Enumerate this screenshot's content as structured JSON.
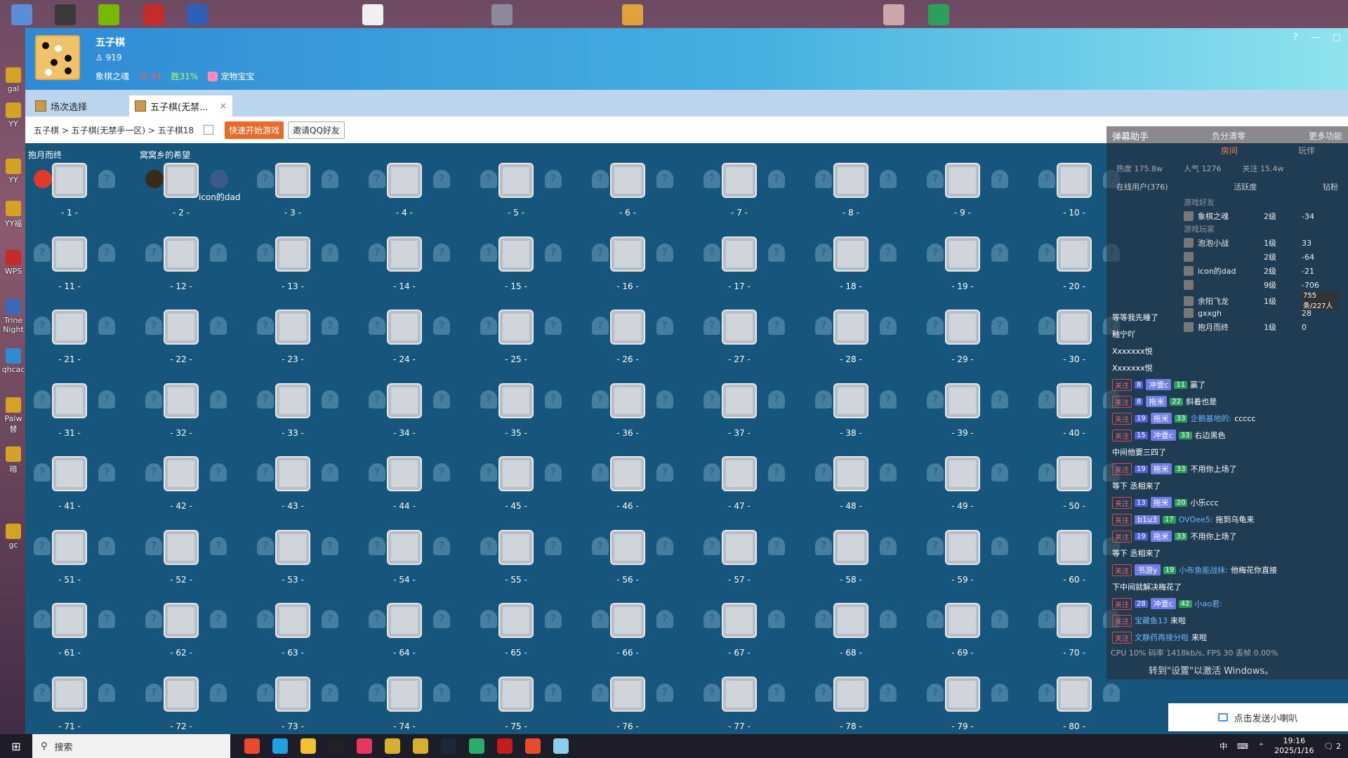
{
  "window": {
    "game_title": "五子棋",
    "points": "919",
    "rank_title": "象棋之魂",
    "score": "分-34",
    "win_rate": "胜31%",
    "pet": "宠物宝宝",
    "controls": [
      "?",
      "—",
      "□"
    ]
  },
  "tabs": [
    {
      "label": "场次选择"
    },
    {
      "label": "五子棋(无禁...",
      "close": "×"
    }
  ],
  "breadcrumb": {
    "path": "五子棋 > 五子棋(无禁手一区) > 五子棋18",
    "quick_start": "快速开始游戏",
    "invite": "邀请QQ好友"
  },
  "tables": {
    "numbers": [
      "- 1 -",
      "- 2 -",
      "- 3 -",
      "- 4 -",
      "- 5 -",
      "- 6 -",
      "- 7 -",
      "- 8 -",
      "- 9 -",
      "- 10 -",
      "- 11 -",
      "- 12 -",
      "- 13 -",
      "- 14 -",
      "- 15 -",
      "- 16 -",
      "- 17 -",
      "- 18 -",
      "- 19 -",
      "- 20 -",
      "- 21 -",
      "- 22 -",
      "- 23 -",
      "- 24 -",
      "- 25 -",
      "- 26 -",
      "- 27 -",
      "- 28 -",
      "- 29 -",
      "- 30 -",
      "- 31 -",
      "- 32 -",
      "- 33 -",
      "- 34 -",
      "- 35 -",
      "- 36 -",
      "- 37 -",
      "- 38 -",
      "- 39 -",
      "- 40 -",
      "- 41 -",
      "- 42 -",
      "- 43 -",
      "- 44 -",
      "- 45 -",
      "- 46 -",
      "- 47 -",
      "- 48 -",
      "- 49 -",
      "- 50 -",
      "- 51 -",
      "- 52 -",
      "- 53 -",
      "- 54 -",
      "- 55 -",
      "- 56 -",
      "- 57 -",
      "- 58 -",
      "- 59 -",
      "- 60 -",
      "- 61 -",
      "- 62 -",
      "- 63 -",
      "- 64 -",
      "- 65 -",
      "- 66 -",
      "- 67 -",
      "- 68 -",
      "- 69 -",
      "- 70 -",
      "- 71 -",
      "- 72 -",
      "- 73 -",
      "- 74 -",
      "- 75 -",
      "- 76 -",
      "- 77 -",
      "- 78 -",
      "- 79 -",
      "- 80 -"
    ],
    "seat_placeholder": "?",
    "table1_player": "抱月而终",
    "table2_player_left": "窝窝乡的希望",
    "table2_player_right": "icon的dad"
  },
  "right_panel": {
    "title": "弹幕助手",
    "more": "更多功能",
    "negative_clear": "负分清零",
    "tabs": [
      "房间",
      "玩伴"
    ],
    "stats": [
      "热度 175.8w",
      "人气 1276",
      "关注 15.4w"
    ],
    "online_users": "在线用户(376)",
    "activity": "活跃度",
    "diamond": "钻粉",
    "section_friends": "游戏好友",
    "section_players": "游戏玩家",
    "rank_rows": [
      {
        "name": "象棋之魂",
        "level": "2级",
        "score": "-34"
      },
      {
        "name": "泡泡小战",
        "level": "1级",
        "score": "33"
      },
      {
        "name": "",
        "level": "2级",
        "score": "-64"
      },
      {
        "name": "icon的dad",
        "level": "2级",
        "score": "-21"
      },
      {
        "name": "",
        "level": "9级",
        "score": "-706"
      },
      {
        "name": "余阳飞龙",
        "level": "1级",
        "score": ""
      },
      {
        "name": "gxxgh",
        "level": "",
        "score": "28"
      },
      {
        "name": "抱月而终",
        "level": "1级",
        "score": "0"
      }
    ],
    "counter": "755条/227人",
    "chat": [
      {
        "text": "等等我先睡了"
      },
      {
        "text": "釉宁吖"
      },
      {
        "text": "Xxxxxxx悦"
      },
      {
        "text": "Xxxxxxx悦"
      },
      {
        "follow": "关注",
        "lv": "8",
        "badge": "冲壹c",
        "fan": "11",
        "msg": "赢了"
      },
      {
        "follow": "关注",
        "lv": "8",
        "badge": "拖米",
        "fan": "22",
        "msg": "斜着也是"
      },
      {
        "follow": "关注",
        "lv": "19",
        "badge": "拖米",
        "fan": "33",
        "user": "企鹅基地的:",
        "msg": "ccccc"
      },
      {
        "follow": "关注",
        "lv": "15",
        "badge": "冲壹c",
        "fan": "33",
        "msg": "右边黑色"
      },
      {
        "text": "中间他要三四了"
      },
      {
        "follow": "关注",
        "lv": "19",
        "badge": "拖米",
        "fan": "33",
        "msg": "不用你上场了"
      },
      {
        "text": "等下 丞相来了"
      },
      {
        "follow": "关注",
        "lv": "13",
        "badge": "拖米",
        "fan": "20",
        "msg": "小乐ccc"
      },
      {
        "follow": "关注",
        "badge": "b1u3",
        "fan": "17",
        "user": "OVOee5:",
        "msg": "拖到乌龟来"
      },
      {
        "follow": "关注",
        "lv": "19",
        "badge": "拖米",
        "fan": "33",
        "msg": "不用你上场了"
      },
      {
        "text": "等下 丞相来了"
      },
      {
        "follow": "关注",
        "badge": "书游y",
        "fan": "19",
        "user": "小布鱼能战抹:",
        "msg": "他梅花你直接"
      },
      {
        "text": "下中间就解决梅花了"
      },
      {
        "follow": "关注",
        "lv": "28",
        "badge": "冲壹c",
        "fan": "42",
        "user": "小ao君:"
      },
      {
        "follow": "关注",
        "user": "宝藏鱼13",
        "msg": "来啦"
      },
      {
        "follow": "关注",
        "user": "文静药再接分啦",
        "msg": "来啦"
      }
    ],
    "cpu": "CPU 10%  码率 1418kb/s, FPS 30  丢帧 0.00%",
    "activate": "转到\"设置\"以激活 Windows。",
    "send": "点击发送小喇叭"
  },
  "taskbar": {
    "search": "搜索",
    "time": "19:16",
    "date": "2025/1/16",
    "ime": "中",
    "notify": "2"
  },
  "desktop_labels": [
    "gal",
    "YY",
    "YY",
    "YY福",
    "WPS",
    "Trine Night",
    "qhcac",
    "Palw 替",
    "暗",
    "gc"
  ],
  "colors": {
    "header_start": "#2f8ad4",
    "header_end": "#8fe3ee",
    "grid_bg": "#16567c",
    "quick_btn": "#e96b2a",
    "follow_red": "#ff6464"
  }
}
